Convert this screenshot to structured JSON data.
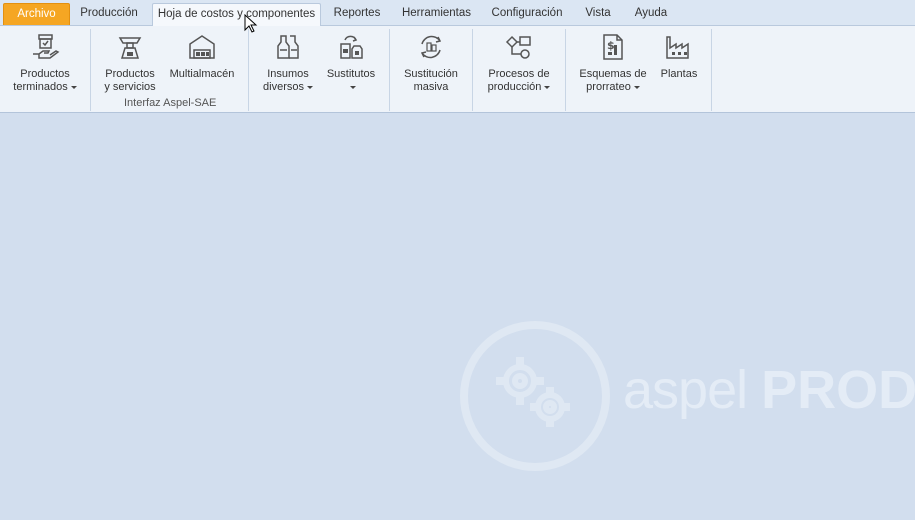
{
  "tabs": [
    {
      "label": "Archivo"
    },
    {
      "label": "Producción"
    },
    {
      "label": "Hoja de costos y componentes"
    },
    {
      "label": "Reportes"
    },
    {
      "label": "Herramientas"
    },
    {
      "label": "Configuración"
    },
    {
      "label": "Vista"
    },
    {
      "label": "Ayuda"
    }
  ],
  "ribbon": {
    "productos_terminados": {
      "line1": "Productos",
      "line2": "terminados"
    },
    "productos_servicios": {
      "line1": "Productos",
      "line2": "y servicios"
    },
    "multialmacen": {
      "line1": "Multialmacén"
    },
    "group_interfaz": "Interfaz Aspel-SAE",
    "insumos_diversos": {
      "line1": "Insumos",
      "line2": "diversos"
    },
    "sustitutos": {
      "line1": "Sustitutos"
    },
    "sustitucion_masiva": {
      "line1": "Sustitución",
      "line2": "masiva"
    },
    "procesos_produccion": {
      "line1": "Procesos de",
      "line2": "producción"
    },
    "esquemas_prorrateo": {
      "line1": "Esquemas de",
      "line2": "prorrateo"
    },
    "plantas": {
      "line1": "Plantas"
    }
  },
  "watermark": {
    "text_light": "aspel",
    "text_bold": "PROD"
  }
}
